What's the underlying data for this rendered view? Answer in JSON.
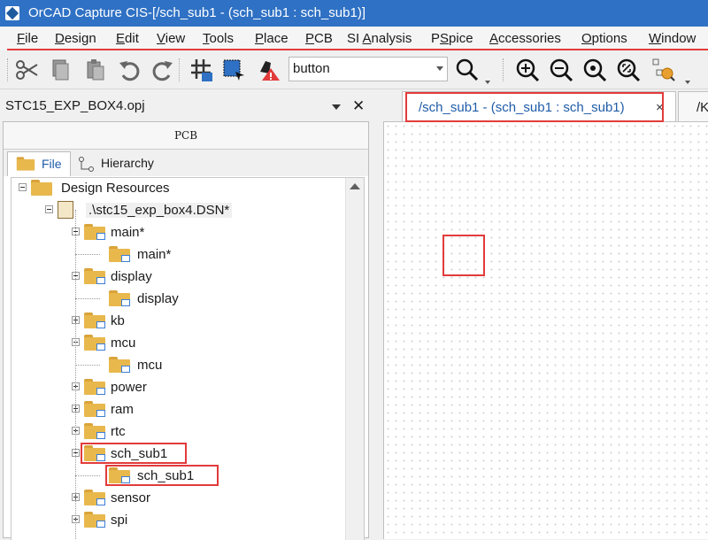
{
  "window": {
    "title": "OrCAD Capture CIS-[/sch_sub1 - (sch_sub1 : sch_sub1)]"
  },
  "menu": [
    {
      "label": "File",
      "ul": "F",
      "rest": "ile"
    },
    {
      "label": "Design",
      "ul": "D",
      "rest": "esign"
    },
    {
      "label": "Edit",
      "ul": "E",
      "rest": "dit"
    },
    {
      "label": "View",
      "ul": "V",
      "rest": "iew"
    },
    {
      "label": "Tools",
      "ul": "T",
      "rest": "ools"
    },
    {
      "label": "Place",
      "ul": "P",
      "rest": "lace"
    },
    {
      "label": "PCB",
      "ul": "P",
      "rest": "CB"
    },
    {
      "label": "SI Analysis",
      "pre": "SI ",
      "ul": "A",
      "rest": "nalysis"
    },
    {
      "label": "PSpice",
      "pre": "P",
      "ul": "S",
      "rest": "pice"
    },
    {
      "label": "Accessories",
      "ul": "A",
      "rest": "ccessories"
    },
    {
      "label": "Options",
      "ul": "O",
      "rest": "ptions"
    },
    {
      "label": "Window",
      "ul": "W",
      "rest": "indow"
    }
  ],
  "toolbar": {
    "icons": [
      "cut-icon",
      "copy-icon",
      "paste-icon",
      "undo-icon",
      "redo-icon",
      "grid-snap-icon",
      "area-select-icon",
      "drc-icon",
      "search-icon",
      "zoom-in-icon",
      "zoom-out-icon",
      "zoom-area-icon",
      "zoom-all-icon",
      "hierarchy-search-icon"
    ],
    "search_value": "button"
  },
  "project_pane": {
    "title": "STC15_EXP_BOX4.opj",
    "pcb_header": "PCB",
    "tabs": [
      "File",
      "Hierarchy"
    ],
    "tree": [
      {
        "label": "Design Resources",
        "level": 0,
        "toggle": "minus",
        "icon": "folder"
      },
      {
        "label": ".\\stc15_exp_box4.DSN*",
        "level": 1,
        "toggle": "minus",
        "icon": "design"
      },
      {
        "label": "main*",
        "level": 2,
        "toggle": "minus",
        "icon": "folder"
      },
      {
        "label": "main*",
        "level": 3,
        "toggle": "none",
        "icon": "folder"
      },
      {
        "label": "display",
        "level": 2,
        "toggle": "minus",
        "icon": "folder"
      },
      {
        "label": "display",
        "level": 3,
        "toggle": "none",
        "icon": "folder"
      },
      {
        "label": "kb",
        "level": 2,
        "toggle": "plus",
        "icon": "folder"
      },
      {
        "label": "mcu",
        "level": 2,
        "toggle": "minus",
        "icon": "folder"
      },
      {
        "label": "mcu",
        "level": 3,
        "toggle": "none",
        "icon": "folder"
      },
      {
        "label": "power",
        "level": 2,
        "toggle": "plus",
        "icon": "folder"
      },
      {
        "label": "ram",
        "level": 2,
        "toggle": "plus",
        "icon": "folder"
      },
      {
        "label": "rtc",
        "level": 2,
        "toggle": "plus",
        "icon": "folder"
      },
      {
        "label": "sch_sub1",
        "level": 2,
        "toggle": "minus",
        "icon": "folder",
        "highlight": true
      },
      {
        "label": "sch_sub1",
        "level": 3,
        "toggle": "none",
        "icon": "folder",
        "highlight": true
      },
      {
        "label": "sensor",
        "level": 2,
        "toggle": "plus",
        "icon": "folder"
      },
      {
        "label": "spi",
        "level": 2,
        "toggle": "plus",
        "icon": "folder"
      }
    ]
  },
  "editor": {
    "tabs": [
      {
        "label": "/sch_sub1 - (sch_sub1 : sch_sub1)",
        "close": "×",
        "active": true
      },
      {
        "label": "/K",
        "active": false
      }
    ]
  },
  "colors": {
    "titlebar": "#2f71c4",
    "highlight": "#e23b3b",
    "active_tab_text": "#1f5ca8"
  }
}
